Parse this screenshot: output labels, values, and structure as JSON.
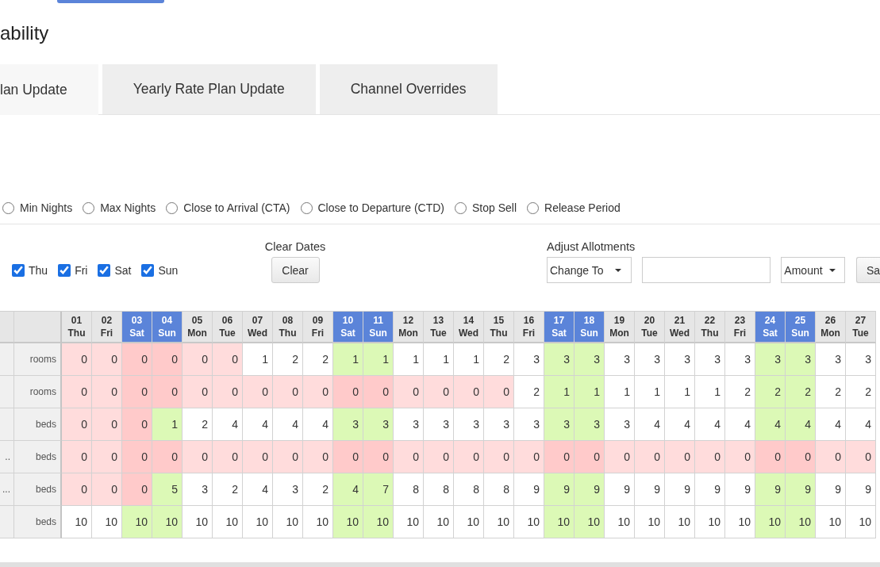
{
  "page": {
    "title": "ability"
  },
  "tabs": [
    {
      "label": "lan Update",
      "selected": true
    },
    {
      "label": "Yearly Rate Plan Update",
      "selected": false
    },
    {
      "label": "Channel Overrides",
      "selected": false
    }
  ],
  "restrictions": [
    {
      "label": "Min Nights",
      "selected": false
    },
    {
      "label": "Max Nights",
      "selected": false
    },
    {
      "label": "Close to Arrival (CTA)",
      "selected": false
    },
    {
      "label": "Close to Departure (CTD)",
      "selected": false
    },
    {
      "label": "Stop Sell",
      "selected": false
    },
    {
      "label": "Release Period",
      "selected": false
    }
  ],
  "weekdays": [
    {
      "label": "Thu",
      "checked": true
    },
    {
      "label": "Fri",
      "checked": true
    },
    {
      "label": "Sat",
      "checked": true
    },
    {
      "label": "Sun",
      "checked": true
    }
  ],
  "clear_dates": {
    "label": "Clear Dates",
    "button": "Clear"
  },
  "adjust_allotments": {
    "label": "Adjust Allotments",
    "mode": "Change To",
    "unit": "Amount",
    "save_button": "Sa"
  },
  "table": {
    "columns": [
      {
        "day": "01",
        "weekday": "Thu",
        "weekend": false
      },
      {
        "day": "02",
        "weekday": "Fri",
        "weekend": false
      },
      {
        "day": "03",
        "weekday": "Sat",
        "weekend": true
      },
      {
        "day": "04",
        "weekday": "Sun",
        "weekend": true
      },
      {
        "day": "05",
        "weekday": "Mon",
        "weekend": false
      },
      {
        "day": "06",
        "weekday": "Tue",
        "weekend": false
      },
      {
        "day": "07",
        "weekday": "Wed",
        "weekend": false
      },
      {
        "day": "08",
        "weekday": "Thu",
        "weekend": false
      },
      {
        "day": "09",
        "weekday": "Fri",
        "weekend": false
      },
      {
        "day": "10",
        "weekday": "Sat",
        "weekend": true
      },
      {
        "day": "11",
        "weekday": "Sun",
        "weekend": true
      },
      {
        "day": "12",
        "weekday": "Mon",
        "weekend": false
      },
      {
        "day": "13",
        "weekday": "Tue",
        "weekend": false
      },
      {
        "day": "14",
        "weekday": "Wed",
        "weekend": false
      },
      {
        "day": "15",
        "weekday": "Thu",
        "weekend": false
      },
      {
        "day": "16",
        "weekday": "Fri",
        "weekend": false
      },
      {
        "day": "17",
        "weekday": "Sat",
        "weekend": true
      },
      {
        "day": "18",
        "weekday": "Sun",
        "weekend": true
      },
      {
        "day": "19",
        "weekday": "Mon",
        "weekend": false
      },
      {
        "day": "20",
        "weekday": "Tue",
        "weekend": false
      },
      {
        "day": "21",
        "weekday": "Wed",
        "weekend": false
      },
      {
        "day": "22",
        "weekday": "Thu",
        "weekend": false
      },
      {
        "day": "23",
        "weekday": "Fri",
        "weekend": false
      },
      {
        "day": "24",
        "weekday": "Sat",
        "weekend": true
      },
      {
        "day": "25",
        "weekday": "Sun",
        "weekend": true
      },
      {
        "day": "26",
        "weekday": "Mon",
        "weekend": false
      },
      {
        "day": "27",
        "weekday": "Tue",
        "weekend": false
      }
    ],
    "rows": [
      {
        "unit": "rooms",
        "cells": [
          {
            "value": "0",
            "sold_out": true
          },
          {
            "value": "0",
            "sold_out": true
          },
          {
            "value": "0",
            "sold_out": true
          },
          {
            "value": "0",
            "sold_out": true
          },
          {
            "value": "0",
            "sold_out": true
          },
          {
            "value": "0",
            "sold_out": true
          },
          {
            "value": "1",
            "sold_out": false
          },
          {
            "value": "2",
            "sold_out": false
          },
          {
            "value": "2",
            "sold_out": false
          },
          {
            "value": "1",
            "sold_out": false
          },
          {
            "value": "1",
            "sold_out": false
          },
          {
            "value": "1",
            "sold_out": false
          },
          {
            "value": "1",
            "sold_out": false
          },
          {
            "value": "1",
            "sold_out": false
          },
          {
            "value": "2",
            "sold_out": false
          },
          {
            "value": "3",
            "sold_out": false
          },
          {
            "value": "3",
            "sold_out": false
          },
          {
            "value": "3",
            "sold_out": false
          },
          {
            "value": "3",
            "sold_out": false
          },
          {
            "value": "3",
            "sold_out": false
          },
          {
            "value": "3",
            "sold_out": false
          },
          {
            "value": "3",
            "sold_out": false
          },
          {
            "value": "3",
            "sold_out": false
          },
          {
            "value": "3",
            "sold_out": false
          },
          {
            "value": "3",
            "sold_out": false
          },
          {
            "value": "3",
            "sold_out": false
          },
          {
            "value": "3",
            "sold_out": false
          }
        ]
      },
      {
        "unit": "rooms",
        "cells": [
          {
            "value": "0",
            "sold_out": true
          },
          {
            "value": "0",
            "sold_out": true
          },
          {
            "value": "0",
            "sold_out": true
          },
          {
            "value": "0",
            "sold_out": true
          },
          {
            "value": "0",
            "sold_out": true
          },
          {
            "value": "0",
            "sold_out": true
          },
          {
            "value": "0",
            "sold_out": true
          },
          {
            "value": "0",
            "sold_out": true
          },
          {
            "value": "0",
            "sold_out": true
          },
          {
            "value": "0",
            "sold_out": true
          },
          {
            "value": "0",
            "sold_out": true
          },
          {
            "value": "0",
            "sold_out": true
          },
          {
            "value": "0",
            "sold_out": true
          },
          {
            "value": "0",
            "sold_out": true
          },
          {
            "value": "0",
            "sold_out": true
          },
          {
            "value": "2",
            "sold_out": false
          },
          {
            "value": "1",
            "sold_out": false
          },
          {
            "value": "1",
            "sold_out": false
          },
          {
            "value": "1",
            "sold_out": false
          },
          {
            "value": "1",
            "sold_out": false
          },
          {
            "value": "1",
            "sold_out": false
          },
          {
            "value": "1",
            "sold_out": false
          },
          {
            "value": "2",
            "sold_out": false
          },
          {
            "value": "2",
            "sold_out": false
          },
          {
            "value": "2",
            "sold_out": false
          },
          {
            "value": "2",
            "sold_out": false
          },
          {
            "value": "2",
            "sold_out": false
          }
        ]
      },
      {
        "unit": "beds",
        "cells": [
          {
            "value": "0",
            "sold_out": true
          },
          {
            "value": "0",
            "sold_out": true
          },
          {
            "value": "0",
            "sold_out": true
          },
          {
            "value": "1",
            "sold_out": false
          },
          {
            "value": "2",
            "sold_out": false
          },
          {
            "value": "4",
            "sold_out": false
          },
          {
            "value": "4",
            "sold_out": false
          },
          {
            "value": "4",
            "sold_out": false
          },
          {
            "value": "4",
            "sold_out": false
          },
          {
            "value": "3",
            "sold_out": false
          },
          {
            "value": "3",
            "sold_out": false
          },
          {
            "value": "3",
            "sold_out": false
          },
          {
            "value": "3",
            "sold_out": false
          },
          {
            "value": "3",
            "sold_out": false
          },
          {
            "value": "3",
            "sold_out": false
          },
          {
            "value": "3",
            "sold_out": false
          },
          {
            "value": "3",
            "sold_out": false
          },
          {
            "value": "3",
            "sold_out": false
          },
          {
            "value": "3",
            "sold_out": false
          },
          {
            "value": "4",
            "sold_out": false
          },
          {
            "value": "4",
            "sold_out": false
          },
          {
            "value": "4",
            "sold_out": false
          },
          {
            "value": "4",
            "sold_out": false
          },
          {
            "value": "4",
            "sold_out": false
          },
          {
            "value": "4",
            "sold_out": false
          },
          {
            "value": "4",
            "sold_out": false
          },
          {
            "value": "4",
            "sold_out": false
          }
        ]
      },
      {
        "name": "..",
        "unit": "beds",
        "cells": [
          {
            "value": "0",
            "sold_out": true
          },
          {
            "value": "0",
            "sold_out": true
          },
          {
            "value": "0",
            "sold_out": true
          },
          {
            "value": "0",
            "sold_out": true
          },
          {
            "value": "0",
            "sold_out": true
          },
          {
            "value": "0",
            "sold_out": true
          },
          {
            "value": "0",
            "sold_out": true
          },
          {
            "value": "0",
            "sold_out": true
          },
          {
            "value": "0",
            "sold_out": true
          },
          {
            "value": "0",
            "sold_out": true
          },
          {
            "value": "0",
            "sold_out": true
          },
          {
            "value": "0",
            "sold_out": true
          },
          {
            "value": "0",
            "sold_out": true
          },
          {
            "value": "0",
            "sold_out": true
          },
          {
            "value": "0",
            "sold_out": true
          },
          {
            "value": "0",
            "sold_out": true
          },
          {
            "value": "0",
            "sold_out": true
          },
          {
            "value": "0",
            "sold_out": true
          },
          {
            "value": "0",
            "sold_out": true
          },
          {
            "value": "0",
            "sold_out": true
          },
          {
            "value": "0",
            "sold_out": true
          },
          {
            "value": "0",
            "sold_out": true
          },
          {
            "value": "0",
            "sold_out": true
          },
          {
            "value": "0",
            "sold_out": true
          },
          {
            "value": "0",
            "sold_out": true
          },
          {
            "value": "0",
            "sold_out": true
          },
          {
            "value": "0",
            "sold_out": true
          }
        ]
      },
      {
        "name": "...",
        "unit": "beds",
        "cells": [
          {
            "value": "0",
            "sold_out": true
          },
          {
            "value": "0",
            "sold_out": true
          },
          {
            "value": "0",
            "sold_out": true
          },
          {
            "value": "5",
            "sold_out": false
          },
          {
            "value": "3",
            "sold_out": false
          },
          {
            "value": "2",
            "sold_out": false
          },
          {
            "value": "4",
            "sold_out": false
          },
          {
            "value": "3",
            "sold_out": false
          },
          {
            "value": "2",
            "sold_out": false
          },
          {
            "value": "4",
            "sold_out": false
          },
          {
            "value": "7",
            "sold_out": false
          },
          {
            "value": "8",
            "sold_out": false
          },
          {
            "value": "8",
            "sold_out": false
          },
          {
            "value": "8",
            "sold_out": false
          },
          {
            "value": "8",
            "sold_out": false
          },
          {
            "value": "9",
            "sold_out": false
          },
          {
            "value": "9",
            "sold_out": false
          },
          {
            "value": "9",
            "sold_out": false
          },
          {
            "value": "9",
            "sold_out": false
          },
          {
            "value": "9",
            "sold_out": false
          },
          {
            "value": "9",
            "sold_out": false
          },
          {
            "value": "9",
            "sold_out": false
          },
          {
            "value": "9",
            "sold_out": false
          },
          {
            "value": "9",
            "sold_out": false
          },
          {
            "value": "9",
            "sold_out": false
          },
          {
            "value": "9",
            "sold_out": false
          },
          {
            "value": "9",
            "sold_out": false
          }
        ]
      },
      {
        "unit": "beds",
        "cells": [
          {
            "value": "10",
            "sold_out": false
          },
          {
            "value": "10",
            "sold_out": false
          },
          {
            "value": "10",
            "sold_out": false
          },
          {
            "value": "10",
            "sold_out": false
          },
          {
            "value": "10",
            "sold_out": false
          },
          {
            "value": "10",
            "sold_out": false
          },
          {
            "value": "10",
            "sold_out": false
          },
          {
            "value": "10",
            "sold_out": false
          },
          {
            "value": "10",
            "sold_out": false
          },
          {
            "value": "10",
            "sold_out": false
          },
          {
            "value": "10",
            "sold_out": false
          },
          {
            "value": "10",
            "sold_out": false
          },
          {
            "value": "10",
            "sold_out": false
          },
          {
            "value": "10",
            "sold_out": false
          },
          {
            "value": "10",
            "sold_out": false
          },
          {
            "value": "10",
            "sold_out": false
          },
          {
            "value": "10",
            "sold_out": false
          },
          {
            "value": "10",
            "sold_out": false
          },
          {
            "value": "10",
            "sold_out": false
          },
          {
            "value": "10",
            "sold_out": false
          },
          {
            "value": "10",
            "sold_out": false
          },
          {
            "value": "10",
            "sold_out": false
          },
          {
            "value": "10",
            "sold_out": false
          },
          {
            "value": "10",
            "sold_out": false
          },
          {
            "value": "10",
            "sold_out": false
          },
          {
            "value": "10",
            "sold_out": false
          },
          {
            "value": "10",
            "sold_out": false
          }
        ]
      }
    ]
  }
}
